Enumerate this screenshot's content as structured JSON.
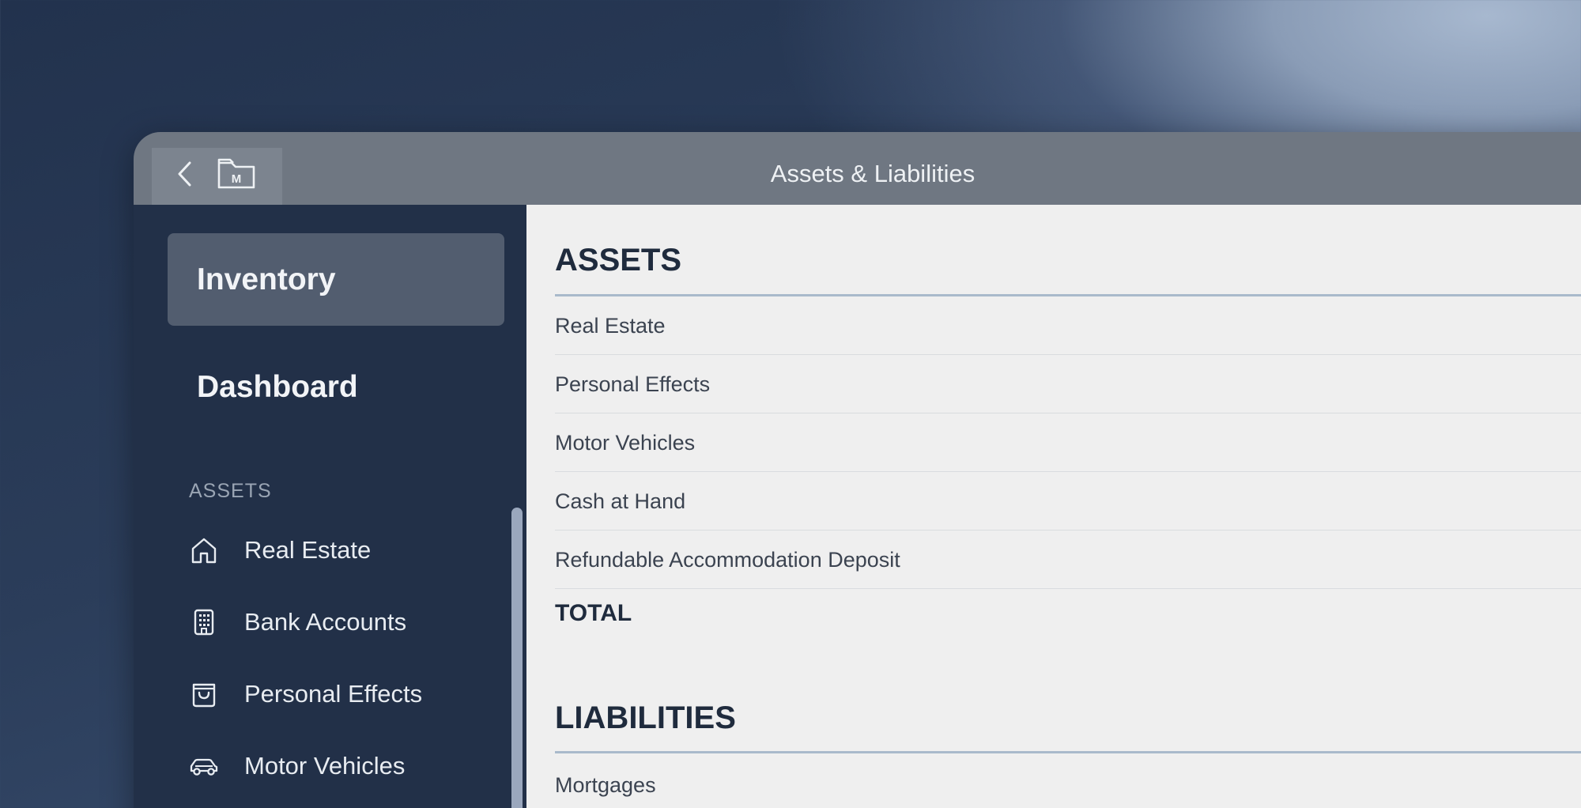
{
  "window": {
    "title": "Assets & Liabilities"
  },
  "toolbar": {
    "back_icon": "chevron-left-icon",
    "folder_icon": "folder-m-icon",
    "folder_letter": "M"
  },
  "sidebar": {
    "primary": [
      {
        "label": "Inventory",
        "active": true
      },
      {
        "label": "Dashboard",
        "active": false
      }
    ],
    "section_label": "ASSETS",
    "items": [
      {
        "label": "Real Estate",
        "icon": "home-icon"
      },
      {
        "label": "Bank Accounts",
        "icon": "building-icon"
      },
      {
        "label": "Personal Effects",
        "icon": "bag-icon"
      },
      {
        "label": "Motor Vehicles",
        "icon": "car-icon"
      }
    ]
  },
  "main": {
    "assets": {
      "heading": "ASSETS",
      "rows": [
        "Real Estate",
        "Personal Effects",
        "Motor Vehicles",
        "Cash at Hand",
        "Refundable Accommodation Deposit"
      ],
      "total_label": "TOTAL"
    },
    "liabilities": {
      "heading": "LIABILITIES",
      "rows": [
        "Mortgages"
      ]
    }
  },
  "colors": {
    "sidebar_bg": "#223048",
    "sidebar_active": "#525d6f",
    "titlebar_bg": "#6f7782",
    "content_bg": "#efefef",
    "section_rule": "#a9bacb"
  }
}
